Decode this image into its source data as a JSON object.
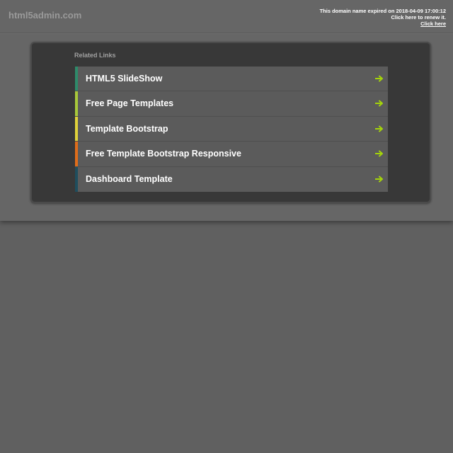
{
  "header": {
    "site_name": "html5admin.com",
    "notice_line1": "This domain name expired on 2018-04-09 17:00:12",
    "notice_line2": "Click here to renew it.",
    "notice_link": "Click here"
  },
  "related_links": {
    "title": "Related Links",
    "items": [
      {
        "label": "HTML5 SlideShow",
        "accent": "#2e8b6a"
      },
      {
        "label": "Free Page Templates",
        "accent": "#a8c83a"
      },
      {
        "label": "Template Bootstrap",
        "accent": "#e0d23a"
      },
      {
        "label": "Free Template Bootstrap Responsive",
        "accent": "#e06d1a"
      },
      {
        "label": "Dashboard Template",
        "accent": "#1f4e5e"
      }
    ],
    "arrow_icon": "arrow-right-icon",
    "arrow_color": "#a4d40a"
  }
}
